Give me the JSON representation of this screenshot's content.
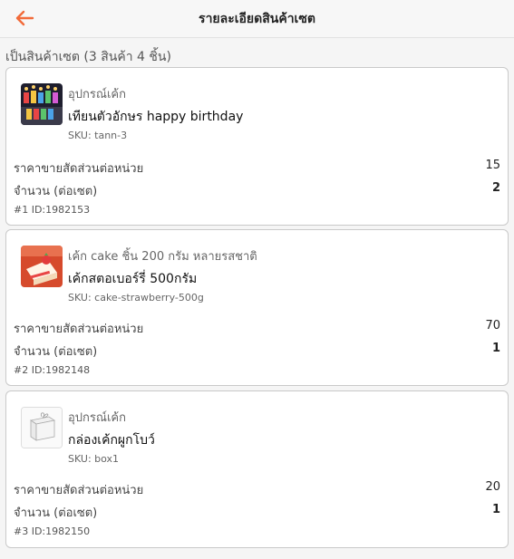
{
  "header": {
    "title": "รายละเอียดสินค้าเซต"
  },
  "summary": "เป็นสินค้าเซต (3 สินค้า 4 ชิ้น)",
  "labels": {
    "unit_price": "ราคาขายสัดส่วนต่อหน่วย",
    "quantity": "จำนวน (ต่อเซต)"
  },
  "colors": {
    "accent": "#F26B3A"
  },
  "items": [
    {
      "category": "อุปกรณ์เค้ก",
      "name": "เทียนตัวอักษร happy birthday",
      "sku": "SKU: tann-3",
      "unit_price": "15",
      "quantity": "2",
      "id_line": "#1 ID:1982153",
      "image_icon": "birthday-candles-image"
    },
    {
      "category": "เค้ก cake ชิ้น 200 กรัม หลายรสชาติ",
      "name": "เค้กสตอเบอร์รี่ 500กรัม",
      "sku": "SKU: cake-strawberry-500g",
      "unit_price": "70",
      "quantity": "1",
      "id_line": "#2 ID:1982148",
      "image_icon": "strawberry-cake-image"
    },
    {
      "category": "อุปกรณ์เค้ก",
      "name": "กล่องเค้กผูกโบว์",
      "sku": "SKU: box1",
      "unit_price": "20",
      "quantity": "1",
      "id_line": "#3 ID:1982150",
      "image_icon": "cake-box-image"
    }
  ]
}
